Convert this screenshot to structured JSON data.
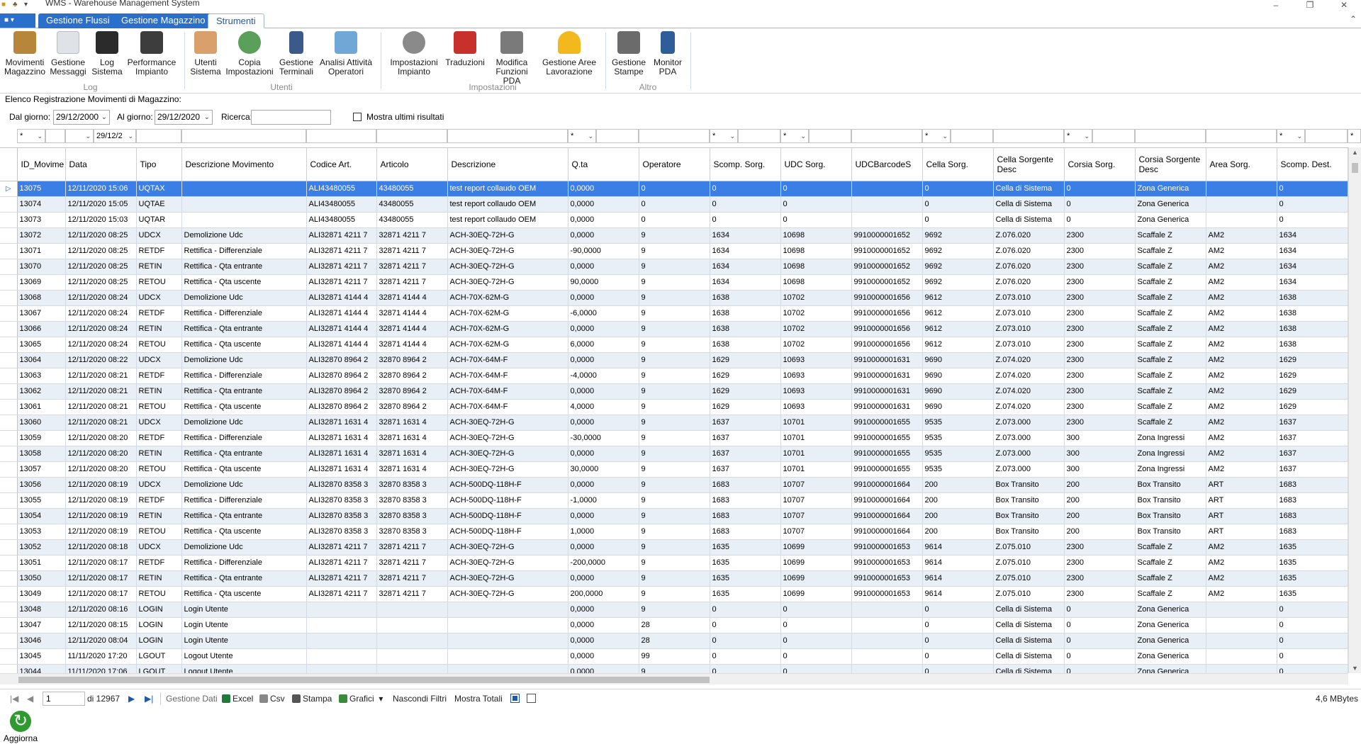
{
  "window": {
    "title": "WMS - Warehouse Management System",
    "controls": [
      "–",
      "❐",
      "✕"
    ]
  },
  "ribbon_tabs": [
    {
      "label": "Gestione Flussi",
      "active": false
    },
    {
      "label": "Gestione Magazzino",
      "active": false
    },
    {
      "label": "Strumenti",
      "active": true
    }
  ],
  "ribbon": {
    "buttons": [
      {
        "l1": "Movimenti",
        "l2": "Magazzino",
        "icon": "forklift-icon",
        "color": "#b8863b"
      },
      {
        "l1": "Gestione",
        "l2": "Messaggi",
        "icon": "envelope-icon",
        "color": "#dfe3e8"
      },
      {
        "l1": "Log",
        "l2": "Sistema",
        "icon": "terminal-icon",
        "color": "#2b2b2b"
      },
      {
        "l1": "Performance",
        "l2": "Impianto",
        "icon": "monitor-chart-icon",
        "color": "#3d3d3d"
      },
      {
        "l1": "Utenti",
        "l2": "Sistema",
        "icon": "users-icon",
        "color": "#d9a06b"
      },
      {
        "l1": "Copia",
        "l2": "Impostazioni",
        "icon": "gear-copy-icon",
        "color": "#5aa05a"
      },
      {
        "l1": "Gestione",
        "l2": "Terminali",
        "icon": "handheld-terminal-icon",
        "color": "#3b5a8a"
      },
      {
        "l1": "Analisi Attività",
        "l2": "Operatori",
        "icon": "activity-analysis-icon",
        "color": "#6fa8d6"
      },
      {
        "l1": "Impostazioni",
        "l2": "Impianto",
        "icon": "settings-gear-icon",
        "color": "#8a8a8a"
      },
      {
        "l1": "Traduzioni",
        "l2": "",
        "icon": "dictionary-icon",
        "color": "#c8302c"
      },
      {
        "l1": "Modifica",
        "l2": "Funzioni PDA",
        "icon": "tools-icon",
        "color": "#7a7a7a"
      },
      {
        "l1": "Gestione Aree",
        "l2": "Lavorazione",
        "icon": "hardhat-icon",
        "color": "#f2b81c"
      },
      {
        "l1": "Gestione",
        "l2": "Stampe",
        "icon": "printer-icon",
        "color": "#6b6b6b"
      },
      {
        "l1": "Monitor",
        "l2": "PDA",
        "icon": "mobile-device-icon",
        "color": "#2f5d9a"
      }
    ],
    "groups": [
      "Log",
      "Utenti",
      "Impostazioni",
      "Altro"
    ]
  },
  "list_title": "Elenco Registrazione Movimenti di Magazzino:",
  "filters": {
    "from_label": "Dal giorno:",
    "from_value": "29/12/2000",
    "to_label": "Al giorno:",
    "to_value": "29/12/2020",
    "search_label": "Ricerca:",
    "search_value": "",
    "last_results_label": "Mostra ultimi risultati",
    "col_filter_star": "*",
    "col_filter_date": "29/12/2"
  },
  "grid": {
    "columns": [
      "ID_Movime",
      "Data",
      "Tipo",
      "Descrizione Movimento",
      "Codice Art.",
      "Articolo",
      "Descrizione",
      "Q.ta",
      "Operatore",
      "Scomp. Sorg.",
      "UDC Sorg.",
      "UDCBarcodeS",
      "Cella Sorg.",
      "Cella Sorgente Desc",
      "Corsia Sorg.",
      "Corsia Sorgente Desc",
      "Area Sorg.",
      "Scomp. Dest."
    ],
    "rows": [
      [
        "13075",
        "12/11/2020 15:06",
        "UQTAX",
        "",
        "ALI43480055",
        "43480055",
        "test report collaudo OEM",
        "0,0000",
        "0",
        "0",
        "0",
        "",
        "0",
        "Cella di Sistema",
        "0",
        "Zona Generica",
        "",
        "0"
      ],
      [
        "13074",
        "12/11/2020 15:05",
        "UQTAE",
        "",
        "ALI43480055",
        "43480055",
        "test report collaudo OEM",
        "0,0000",
        "0",
        "0",
        "0",
        "",
        "0",
        "Cella di Sistema",
        "0",
        "Zona Generica",
        "",
        "0"
      ],
      [
        "13073",
        "12/11/2020 15:03",
        "UQTAR",
        "",
        "ALI43480055",
        "43480055",
        "test report collaudo OEM",
        "0,0000",
        "0",
        "0",
        "0",
        "",
        "0",
        "Cella di Sistema",
        "0",
        "Zona Generica",
        "",
        "0"
      ],
      [
        "13072",
        "12/11/2020 08:25",
        "UDCX",
        "Demolizione Udc",
        "ALI32871 4211 7",
        "32871 4211 7",
        "ACH-30EQ-72H-G",
        "0,0000",
        "9",
        "1634",
        "10698",
        "9910000001652",
        "9692",
        "Z.076.020",
        "2300",
        "Scaffale Z",
        "AM2",
        "1634"
      ],
      [
        "13071",
        "12/11/2020 08:25",
        "RETDF",
        "Rettifica - Differenziale",
        "ALI32871 4211 7",
        "32871 4211 7",
        "ACH-30EQ-72H-G",
        "-90,0000",
        "9",
        "1634",
        "10698",
        "9910000001652",
        "9692",
        "Z.076.020",
        "2300",
        "Scaffale Z",
        "AM2",
        "1634"
      ],
      [
        "13070",
        "12/11/2020 08:25",
        "RETIN",
        "Rettifica - Qta entrante",
        "ALI32871 4211 7",
        "32871 4211 7",
        "ACH-30EQ-72H-G",
        "0,0000",
        "9",
        "1634",
        "10698",
        "9910000001652",
        "9692",
        "Z.076.020",
        "2300",
        "Scaffale Z",
        "AM2",
        "1634"
      ],
      [
        "13069",
        "12/11/2020 08:25",
        "RETOU",
        "Rettifica - Qta uscente",
        "ALI32871 4211 7",
        "32871 4211 7",
        "ACH-30EQ-72H-G",
        "90,0000",
        "9",
        "1634",
        "10698",
        "9910000001652",
        "9692",
        "Z.076.020",
        "2300",
        "Scaffale Z",
        "AM2",
        "1634"
      ],
      [
        "13068",
        "12/11/2020 08:24",
        "UDCX",
        "Demolizione Udc",
        "ALI32871 4144 4",
        "32871 4144 4",
        "ACH-70X-62M-G",
        "0,0000",
        "9",
        "1638",
        "10702",
        "9910000001656",
        "9612",
        "Z.073.010",
        "2300",
        "Scaffale Z",
        "AM2",
        "1638"
      ],
      [
        "13067",
        "12/11/2020 08:24",
        "RETDF",
        "Rettifica - Differenziale",
        "ALI32871 4144 4",
        "32871 4144 4",
        "ACH-70X-62M-G",
        "-6,0000",
        "9",
        "1638",
        "10702",
        "9910000001656",
        "9612",
        "Z.073.010",
        "2300",
        "Scaffale Z",
        "AM2",
        "1638"
      ],
      [
        "13066",
        "12/11/2020 08:24",
        "RETIN",
        "Rettifica - Qta entrante",
        "ALI32871 4144 4",
        "32871 4144 4",
        "ACH-70X-62M-G",
        "0,0000",
        "9",
        "1638",
        "10702",
        "9910000001656",
        "9612",
        "Z.073.010",
        "2300",
        "Scaffale Z",
        "AM2",
        "1638"
      ],
      [
        "13065",
        "12/11/2020 08:24",
        "RETOU",
        "Rettifica - Qta uscente",
        "ALI32871 4144 4",
        "32871 4144 4",
        "ACH-70X-62M-G",
        "6,0000",
        "9",
        "1638",
        "10702",
        "9910000001656",
        "9612",
        "Z.073.010",
        "2300",
        "Scaffale Z",
        "AM2",
        "1638"
      ],
      [
        "13064",
        "12/11/2020 08:22",
        "UDCX",
        "Demolizione Udc",
        "ALI32870 8964 2",
        "32870 8964 2",
        "ACH-70X-64M-F",
        "0,0000",
        "9",
        "1629",
        "10693",
        "9910000001631",
        "9690",
        "Z.074.020",
        "2300",
        "Scaffale Z",
        "AM2",
        "1629"
      ],
      [
        "13063",
        "12/11/2020 08:21",
        "RETDF",
        "Rettifica - Differenziale",
        "ALI32870 8964 2",
        "32870 8964 2",
        "ACH-70X-64M-F",
        "-4,0000",
        "9",
        "1629",
        "10693",
        "9910000001631",
        "9690",
        "Z.074.020",
        "2300",
        "Scaffale Z",
        "AM2",
        "1629"
      ],
      [
        "13062",
        "12/11/2020 08:21",
        "RETIN",
        "Rettifica - Qta entrante",
        "ALI32870 8964 2",
        "32870 8964 2",
        "ACH-70X-64M-F",
        "0,0000",
        "9",
        "1629",
        "10693",
        "9910000001631",
        "9690",
        "Z.074.020",
        "2300",
        "Scaffale Z",
        "AM2",
        "1629"
      ],
      [
        "13061",
        "12/11/2020 08:21",
        "RETOU",
        "Rettifica - Qta uscente",
        "ALI32870 8964 2",
        "32870 8964 2",
        "ACH-70X-64M-F",
        "4,0000",
        "9",
        "1629",
        "10693",
        "9910000001631",
        "9690",
        "Z.074.020",
        "2300",
        "Scaffale Z",
        "AM2",
        "1629"
      ],
      [
        "13060",
        "12/11/2020 08:21",
        "UDCX",
        "Demolizione Udc",
        "ALI32871 1631 4",
        "32871 1631 4",
        "ACH-30EQ-72H-G",
        "0,0000",
        "9",
        "1637",
        "10701",
        "9910000001655",
        "9535",
        "Z.073.000",
        "2300",
        "Scaffale Z",
        "AM2",
        "1637"
      ],
      [
        "13059",
        "12/11/2020 08:20",
        "RETDF",
        "Rettifica - Differenziale",
        "ALI32871 1631 4",
        "32871 1631 4",
        "ACH-30EQ-72H-G",
        "-30,0000",
        "9",
        "1637",
        "10701",
        "9910000001655",
        "9535",
        "Z.073.000",
        "300",
        "Zona Ingressi",
        "AM2",
        "1637"
      ],
      [
        "13058",
        "12/11/2020 08:20",
        "RETIN",
        "Rettifica - Qta entrante",
        "ALI32871 1631 4",
        "32871 1631 4",
        "ACH-30EQ-72H-G",
        "0,0000",
        "9",
        "1637",
        "10701",
        "9910000001655",
        "9535",
        "Z.073.000",
        "300",
        "Zona Ingressi",
        "AM2",
        "1637"
      ],
      [
        "13057",
        "12/11/2020 08:20",
        "RETOU",
        "Rettifica - Qta uscente",
        "ALI32871 1631 4",
        "32871 1631 4",
        "ACH-30EQ-72H-G",
        "30,0000",
        "9",
        "1637",
        "10701",
        "9910000001655",
        "9535",
        "Z.073.000",
        "300",
        "Zona Ingressi",
        "AM2",
        "1637"
      ],
      [
        "13056",
        "12/11/2020 08:19",
        "UDCX",
        "Demolizione Udc",
        "ALI32870 8358 3",
        "32870 8358 3",
        "ACH-500DQ-118H-F",
        "0,0000",
        "9",
        "1683",
        "10707",
        "9910000001664",
        "200",
        "Box Transito",
        "200",
        "Box Transito",
        "ART",
        "1683"
      ],
      [
        "13055",
        "12/11/2020 08:19",
        "RETDF",
        "Rettifica - Differenziale",
        "ALI32870 8358 3",
        "32870 8358 3",
        "ACH-500DQ-118H-F",
        "-1,0000",
        "9",
        "1683",
        "10707",
        "9910000001664",
        "200",
        "Box Transito",
        "200",
        "Box Transito",
        "ART",
        "1683"
      ],
      [
        "13054",
        "12/11/2020 08:19",
        "RETIN",
        "Rettifica - Qta entrante",
        "ALI32870 8358 3",
        "32870 8358 3",
        "ACH-500DQ-118H-F",
        "0,0000",
        "9",
        "1683",
        "10707",
        "9910000001664",
        "200",
        "Box Transito",
        "200",
        "Box Transito",
        "ART",
        "1683"
      ],
      [
        "13053",
        "12/11/2020 08:19",
        "RETOU",
        "Rettifica - Qta uscente",
        "ALI32870 8358 3",
        "32870 8358 3",
        "ACH-500DQ-118H-F",
        "1,0000",
        "9",
        "1683",
        "10707",
        "9910000001664",
        "200",
        "Box Transito",
        "200",
        "Box Transito",
        "ART",
        "1683"
      ],
      [
        "13052",
        "12/11/2020 08:18",
        "UDCX",
        "Demolizione Udc",
        "ALI32871 4211 7",
        "32871 4211 7",
        "ACH-30EQ-72H-G",
        "0,0000",
        "9",
        "1635",
        "10699",
        "9910000001653",
        "9614",
        "Z.075.010",
        "2300",
        "Scaffale Z",
        "AM2",
        "1635"
      ],
      [
        "13051",
        "12/11/2020 08:17",
        "RETDF",
        "Rettifica - Differenziale",
        "ALI32871 4211 7",
        "32871 4211 7",
        "ACH-30EQ-72H-G",
        "-200,0000",
        "9",
        "1635",
        "10699",
        "9910000001653",
        "9614",
        "Z.075.010",
        "2300",
        "Scaffale Z",
        "AM2",
        "1635"
      ],
      [
        "13050",
        "12/11/2020 08:17",
        "RETIN",
        "Rettifica - Qta entrante",
        "ALI32871 4211 7",
        "32871 4211 7",
        "ACH-30EQ-72H-G",
        "0,0000",
        "9",
        "1635",
        "10699",
        "9910000001653",
        "9614",
        "Z.075.010",
        "2300",
        "Scaffale Z",
        "AM2",
        "1635"
      ],
      [
        "13049",
        "12/11/2020 08:17",
        "RETOU",
        "Rettifica - Qta uscente",
        "ALI32871 4211 7",
        "32871 4211 7",
        "ACH-30EQ-72H-G",
        "200,0000",
        "9",
        "1635",
        "10699",
        "9910000001653",
        "9614",
        "Z.075.010",
        "2300",
        "Scaffale Z",
        "AM2",
        "1635"
      ],
      [
        "13048",
        "12/11/2020 08:16",
        "LOGIN",
        "Login Utente",
        "",
        "",
        "",
        "0,0000",
        "9",
        "0",
        "0",
        "",
        "0",
        "Cella di Sistema",
        "0",
        "Zona Generica",
        "",
        "0"
      ],
      [
        "13047",
        "12/11/2020 08:15",
        "LOGIN",
        "Login Utente",
        "",
        "",
        "",
        "0,0000",
        "28",
        "0",
        "0",
        "",
        "0",
        "Cella di Sistema",
        "0",
        "Zona Generica",
        "",
        "0"
      ],
      [
        "13046",
        "12/11/2020 08:04",
        "LOGIN",
        "Login Utente",
        "",
        "",
        "",
        "0,0000",
        "28",
        "0",
        "0",
        "",
        "0",
        "Cella di Sistema",
        "0",
        "Zona Generica",
        "",
        "0"
      ],
      [
        "13045",
        "11/11/2020 17:20",
        "LGOUT",
        "Logout Utente",
        "",
        "",
        "",
        "0,0000",
        "99",
        "0",
        "0",
        "",
        "0",
        "Cella di Sistema",
        "0",
        "Zona Generica",
        "",
        "0"
      ],
      [
        "13044",
        "11/11/2020 17:06",
        "LGOUT",
        "Logout Utente",
        "",
        "",
        "",
        "0,0000",
        "9",
        "0",
        "0",
        "",
        "0",
        "Cella di Sistema",
        "0",
        "Zona Generica",
        "",
        "0"
      ]
    ],
    "selected_row": 0
  },
  "pager": {
    "page_value": "1",
    "of_label": "di 12967",
    "gestione_dati": "Gestione Dati",
    "excel": "Excel",
    "csv": "Csv",
    "stampa": "Stampa",
    "grafici": "Grafici",
    "nascondi_filtri": "Nascondi Filtri",
    "mostra_totali": "Mostra Totali",
    "memory": "4,6 MBytes"
  },
  "refresh_label": "Aggiorna"
}
